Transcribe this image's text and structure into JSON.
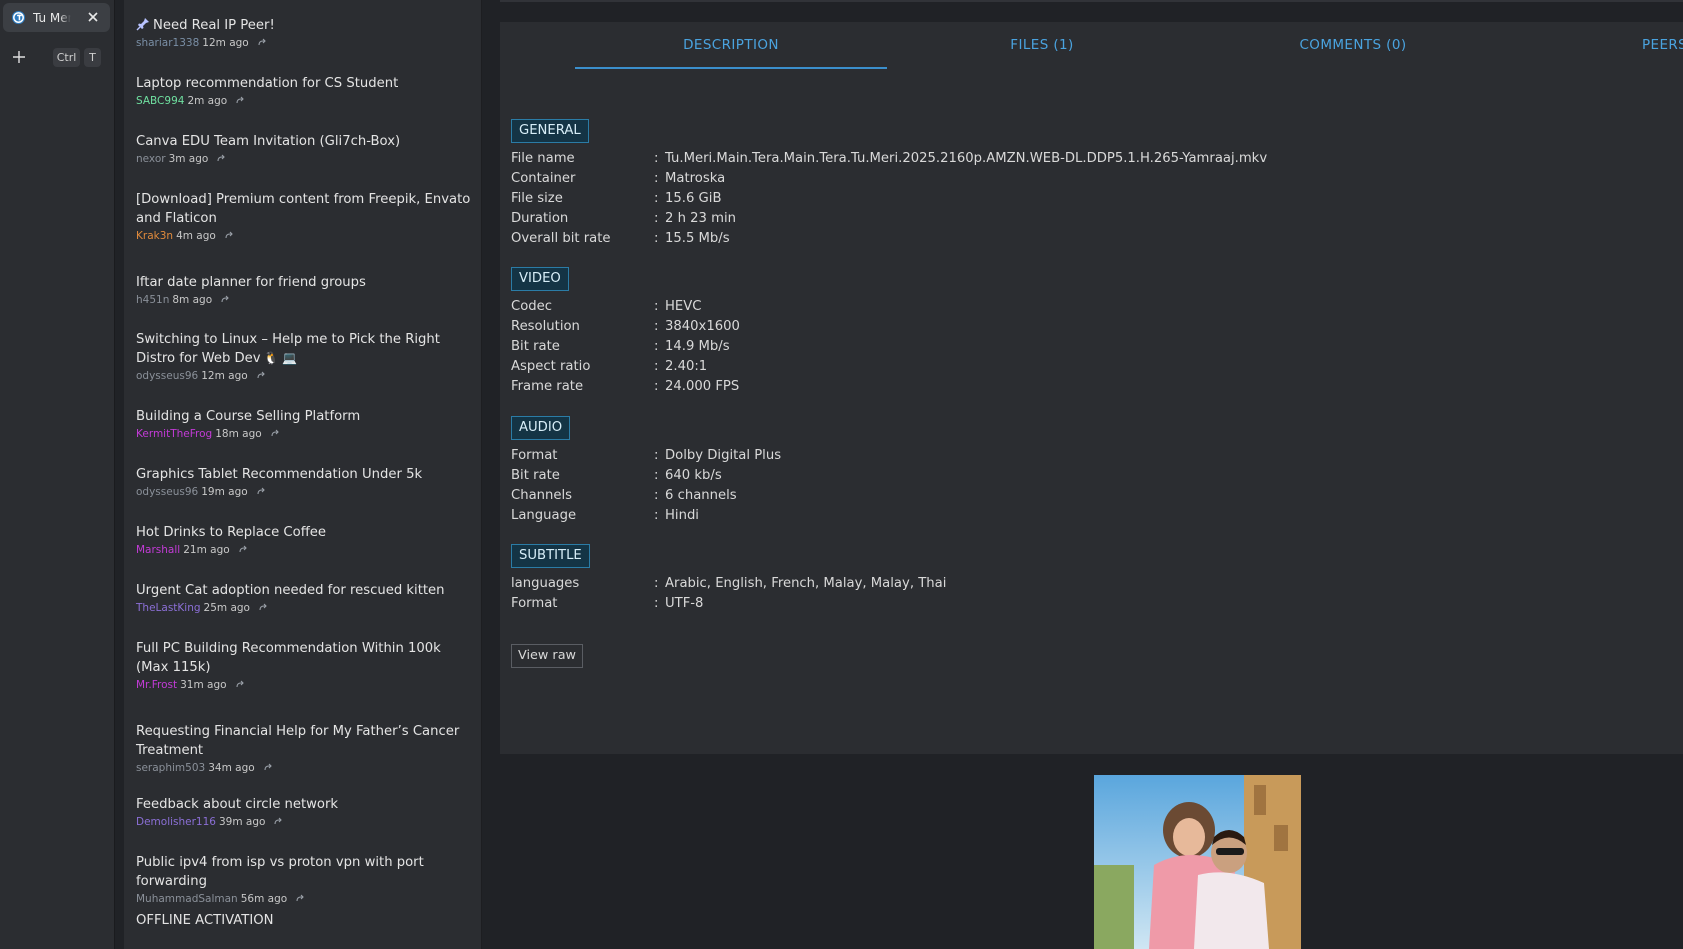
{
  "browser": {
    "tab_title": "Tu Meri",
    "shortcut_ctrl": "Ctrl",
    "shortcut_key": "T",
    "icons": [
      "site-favicon",
      "close-icon",
      "plus-icon"
    ]
  },
  "feed": {
    "items": [
      {
        "title": "Need Real IP Peer!",
        "author": "shariar1338",
        "author_color": "#7a8fa6",
        "time": "12m ago",
        "pinned": true
      },
      {
        "title": "Laptop recommendation for CS Student",
        "author": "SABC994",
        "author_color": "#6fe0a0",
        "time": "2m ago"
      },
      {
        "title": "Canva EDU Team Invitation (Gli7ch-Box)",
        "author": "nexor",
        "author_color": "#8a9099",
        "time": "3m ago"
      },
      {
        "title": "[Download] Premium content from Freepik, Envato and Flaticon",
        "author": "Krak3n",
        "author_color": "#e08a3c",
        "time": "4m ago"
      },
      {
        "title": "Iftar date planner for friend groups",
        "author": "h451n",
        "author_color": "#8a9099",
        "time": "8m ago"
      },
      {
        "title": "Switching to Linux – Help me to Pick the Right Distro for Web Dev",
        "emoji": "🐧 💻",
        "author": "odysseus96",
        "author_color": "#8a9099",
        "time": "12m ago"
      },
      {
        "title": "Building a Course Selling Platform",
        "author": "KermitTheFrog",
        "author_color": "#c23bd6",
        "time": "18m ago"
      },
      {
        "title": "Graphics Tablet Recommendation Under 5k",
        "author": "odysseus96",
        "author_color": "#8a9099",
        "time": "19m ago"
      },
      {
        "title": "Hot Drinks to Replace Coffee",
        "author": "Marshall",
        "author_color": "#c23bd6",
        "time": "21m ago"
      },
      {
        "title": "Urgent Cat adoption needed for rescued kitten",
        "author": "TheLastKing",
        "author_color": "#8b6fd6",
        "time": "25m ago"
      },
      {
        "title": "Full PC Building Recommendation Within 100k (Max 115k)",
        "author": "Mr.Frost",
        "author_color": "#c23bd6",
        "time": "31m ago"
      },
      {
        "title": "Requesting Financial Help for My Father’s Cancer Treatment",
        "author": "seraphim503",
        "author_color": "#8a9099",
        "time": "34m ago"
      },
      {
        "title": "Feedback about circle network",
        "author": "Demolisher116",
        "author_color": "#8b6fd6",
        "time": "39m ago"
      },
      {
        "title": "Public ipv4 from isp vs proton vpn with port forwarding",
        "author": "MuhammadSalman",
        "author_color": "#8a9099",
        "time": "56m ago"
      },
      {
        "title": "OFFLINE ACTIVATION",
        "author": "",
        "author_color": "#8a9099",
        "time": ""
      }
    ]
  },
  "tabs": {
    "description": "DESCRIPTION",
    "files": "FILES (1)",
    "comments": "COMMENTS (0)",
    "peers": "PEERS",
    "active": "description"
  },
  "mediainfo": {
    "sections": [
      {
        "header": "GENERAL",
        "rows": [
          {
            "key": "File name",
            "value": "Tu.Meri.Main.Tera.Main.Tera.Tu.Meri.2025.2160p.AMZN.WEB-DL.DDP5.1.H.265-Yamraaj.mkv"
          },
          {
            "key": "Container",
            "value": "Matroska"
          },
          {
            "key": "File size",
            "value": "15.6 GiB"
          },
          {
            "key": "Duration",
            "value": "2 h 23 min"
          },
          {
            "key": "Overall bit rate",
            "value": "15.5 Mb/s"
          }
        ]
      },
      {
        "header": "VIDEO",
        "rows": [
          {
            "key": "Codec",
            "value": "HEVC"
          },
          {
            "key": "Resolution",
            "value": "3840x1600"
          },
          {
            "key": "Bit rate",
            "value": "14.9 Mb/s"
          },
          {
            "key": "Aspect ratio",
            "value": "2.40:1"
          },
          {
            "key": "Frame rate",
            "value": "24.000 FPS"
          }
        ]
      },
      {
        "header": "AUDIO",
        "rows": [
          {
            "key": "Format",
            "value": "Dolby Digital Plus"
          },
          {
            "key": "Bit rate",
            "value": "640 kb/s"
          },
          {
            "key": "Channels",
            "value": "6 channels"
          },
          {
            "key": "Language",
            "value": "Hindi"
          }
        ]
      },
      {
        "header": "SUBTITLE",
        "rows": [
          {
            "key": "languages",
            "value": "Arabic, English, French, Malay, Malay, Thai"
          },
          {
            "key": "Format",
            "value": "UTF-8"
          }
        ]
      }
    ],
    "separator": ":",
    "view_raw": "View raw"
  },
  "colors": {
    "accent": "#4aa3df",
    "section_bg": "#143445",
    "section_border": "#2b7ca6"
  }
}
